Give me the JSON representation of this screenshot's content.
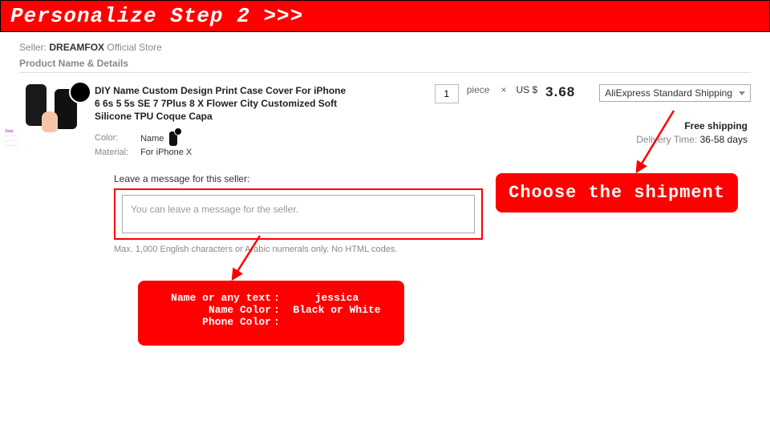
{
  "header": {
    "step_text": "Personalize Step 2 >>>"
  },
  "seller": {
    "label": "Seller:",
    "name": "DREAMFOX",
    "store": "Official Store"
  },
  "section_label": "Product Name & Details",
  "product": {
    "title": "DIY Name Custom Design Print Case Cover For iPhone 6 6s 5 5s SE 7 7Plus 8 X Flower City Customized Soft Silicone TPU Coque Capa",
    "color_label": "Color:",
    "color_value": "Name",
    "material_label": "Material:",
    "material_value": "For iPhone X"
  },
  "purchase": {
    "qty": "1",
    "unit": "piece",
    "times": "×",
    "currency": "US $",
    "price": "3.68",
    "shipping_option": "AliExpress Standard Shipping"
  },
  "shipping_info": {
    "free": "Free shipping",
    "dt_label": "Delivery Time:",
    "dt_value": "36-58 days"
  },
  "message": {
    "section_label": "Leave a message for this seller:",
    "placeholder": "You can leave a message for the seller.",
    "note": "Max. 1,000 English characters or Arabic numerals only. No HTML codes."
  },
  "callouts": {
    "shipment": "Choose the shipment",
    "form": {
      "row1_label": "Name or any text",
      "row1_value": "jessica",
      "row2_label": "Name Color",
      "row2_value": "Black or White",
      "row3_label": "Phone Color",
      "row3_value": ""
    }
  }
}
